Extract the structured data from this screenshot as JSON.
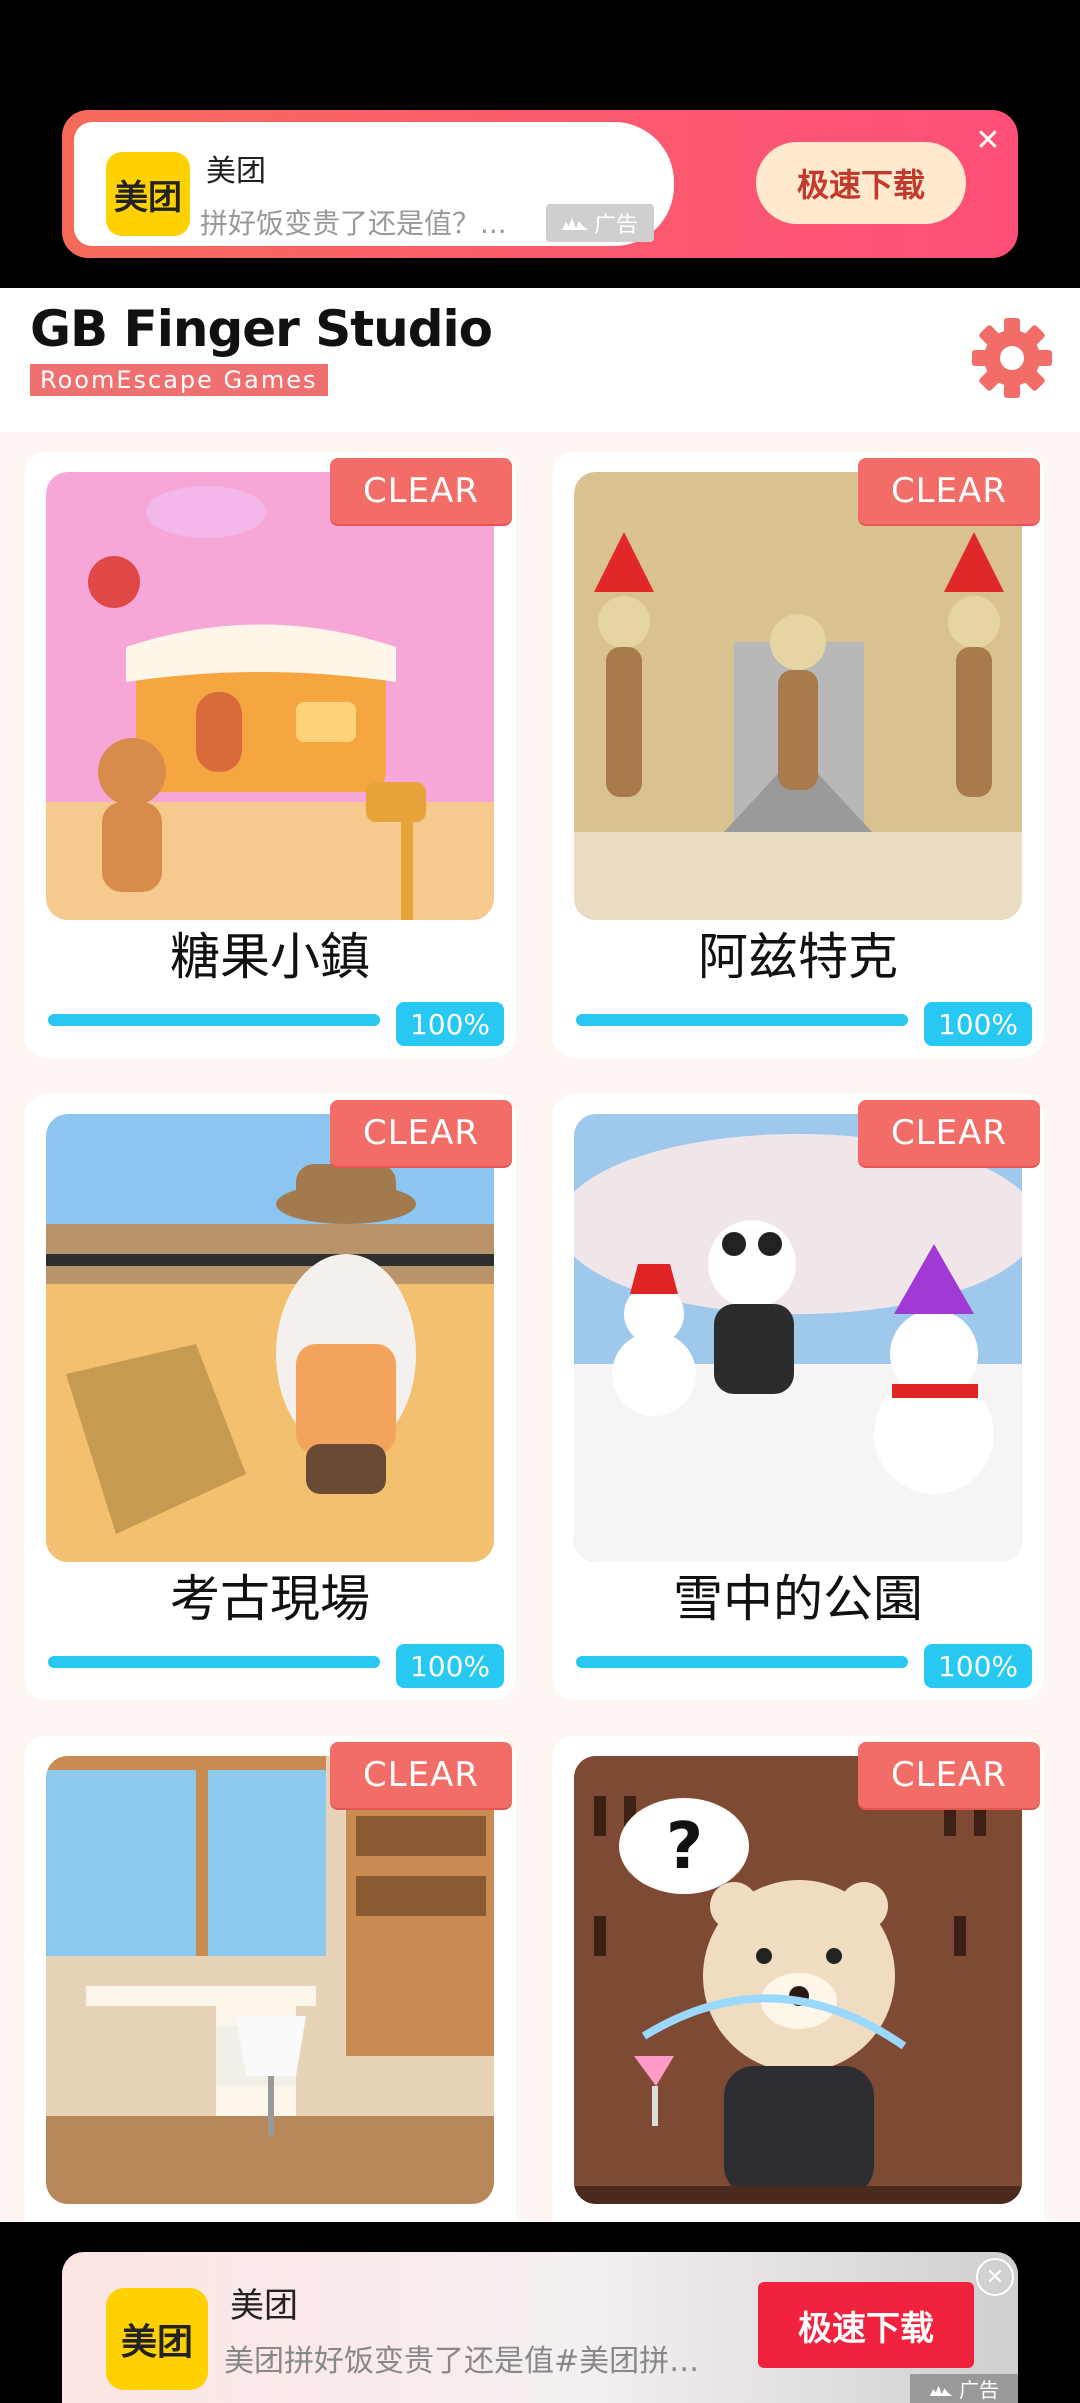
{
  "ad_top": {
    "logo_text": "美团",
    "title": "美团",
    "description": "拼好饭变贵了还是值？...",
    "tag": "广告",
    "download_label": "极速下载",
    "close_icon": "close-icon"
  },
  "header": {
    "brand": "GB Finger Studio",
    "subtitle": "RoomEscape  Games",
    "settings_icon": "gear-icon",
    "accent_color": "#f07070"
  },
  "games": [
    {
      "name": "糖果小鎮",
      "badge": "CLEAR",
      "progress_label": "100%",
      "progress": 1.0,
      "scene": "candy-town"
    },
    {
      "name": "阿兹特克",
      "badge": "CLEAR",
      "progress_label": "100%",
      "progress": 1.0,
      "scene": "aztec-temple"
    },
    {
      "name": "考古現場",
      "badge": "CLEAR",
      "progress_label": "100%",
      "progress": 1.0,
      "scene": "excavation-site"
    },
    {
      "name": "雪中的公園",
      "badge": "CLEAR",
      "progress_label": "100%",
      "progress": 1.0,
      "scene": "snowy-park"
    },
    {
      "name": "",
      "badge": "CLEAR",
      "progress_label": "",
      "scene": "study-room"
    },
    {
      "name": "",
      "badge": "CLEAR",
      "progress_label": "",
      "scene": "bear-bar"
    }
  ],
  "ad_bottom": {
    "logo_text": "美团",
    "title": "美团",
    "description": "美团拼好饭变贵了还是值#美团拼…",
    "tag": "广告",
    "download_label": "极速下载",
    "close_icon": "close-icon"
  },
  "colors": {
    "progress": "#27c8f2",
    "clear_badge": "#f26d68",
    "grid_bg": "#fdf6f2"
  }
}
